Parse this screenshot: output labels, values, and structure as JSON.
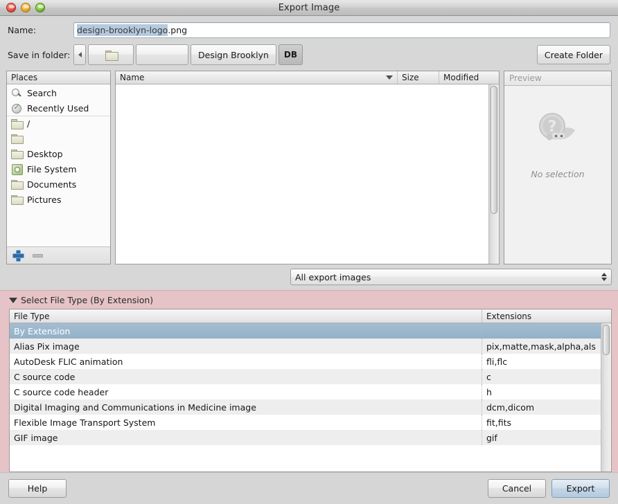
{
  "window": {
    "title": "Export Image",
    "traffic_lights": [
      {
        "name": "close-button",
        "color": "#e8554a"
      },
      {
        "name": "minimize-button",
        "color": "#eeab36"
      },
      {
        "name": "maximize-button",
        "color": "#7dc23c"
      }
    ]
  },
  "name_row": {
    "label": "Name:",
    "value_selected": "design-brooklyn-logo",
    "value_rest": ".png",
    "full_value": "design-brooklyn-logo.png"
  },
  "folder_row": {
    "label": "Save in folder:",
    "crumbs": [
      {
        "label": "",
        "icon": "left-arrow-icon",
        "type": "arrow"
      },
      {
        "label": "",
        "icon": "folder-icon",
        "type": "folder"
      },
      {
        "label": "",
        "icon": "",
        "type": "blank"
      },
      {
        "label": "Design Brooklyn",
        "icon": "",
        "type": "named"
      },
      {
        "label": "DB",
        "icon": "",
        "type": "active"
      }
    ],
    "create_folder_label": "Create Folder"
  },
  "places": {
    "header": "Places",
    "items": [
      {
        "label": "Search",
        "icon": "search-icon"
      },
      {
        "label": "Recently Used",
        "icon": "recent-icon"
      },
      {
        "label": "/",
        "icon": "folder-icon"
      },
      {
        "label": "",
        "icon": "folder-icon"
      },
      {
        "label": "Desktop",
        "icon": "folder-icon"
      },
      {
        "label": "File System",
        "icon": "disk-icon"
      },
      {
        "label": "Documents",
        "icon": "folder-icon"
      },
      {
        "label": "Pictures",
        "icon": "folder-icon"
      }
    ],
    "add_label": "+",
    "remove_label": "−"
  },
  "file_list": {
    "columns": [
      {
        "label": "Name",
        "sorted": true
      },
      {
        "label": "Size"
      },
      {
        "label": "Modified"
      }
    ],
    "rows": []
  },
  "preview": {
    "header": "Preview",
    "note": "No selection",
    "icon": "wilber-question-icon"
  },
  "filter": {
    "selected": "All export images"
  },
  "expander": {
    "title": "Select File Type (By Extension)",
    "expanded": true,
    "columns": [
      "File Type",
      "Extensions"
    ],
    "rows": [
      {
        "file_type": "By Extension",
        "extensions": "",
        "selected": true
      },
      {
        "file_type": "Alias Pix image",
        "extensions": "pix,matte,mask,alpha,als",
        "selected": false
      },
      {
        "file_type": "AutoDesk FLIC animation",
        "extensions": "fli,flc",
        "selected": false
      },
      {
        "file_type": "C source code",
        "extensions": "c",
        "selected": false
      },
      {
        "file_type": "C source code header",
        "extensions": "h",
        "selected": false
      },
      {
        "file_type": "Digital Imaging and Communications in Medicine image",
        "extensions": "dcm,dicom",
        "selected": false
      },
      {
        "file_type": "Flexible Image Transport System",
        "extensions": "fit,fits",
        "selected": false
      },
      {
        "file_type": "GIF image",
        "extensions": "gif",
        "selected": false
      }
    ]
  },
  "buttons": {
    "help": "Help",
    "cancel": "Cancel",
    "export": "Export"
  },
  "colors": {
    "expander_bg": "#e5c3c6",
    "selection_blue": "#9ab8cf",
    "default_button": "#c2d5e6"
  }
}
